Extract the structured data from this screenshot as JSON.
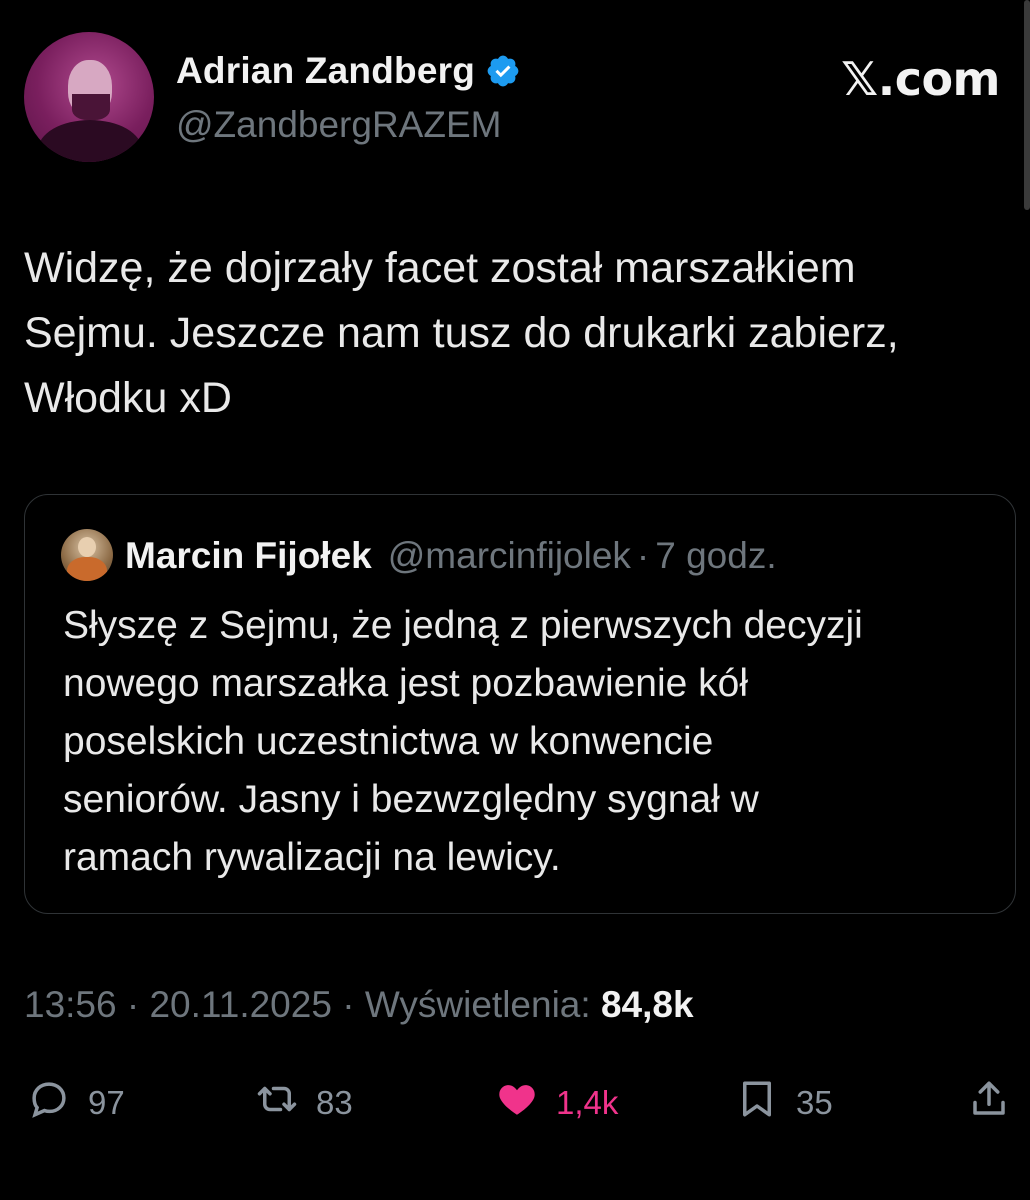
{
  "author": {
    "display_name": "Adrian Zandberg",
    "handle": "@ZandbergRAZEM",
    "verified": true
  },
  "brand": "𝕏.com",
  "tweet": {
    "text": "Widzę, że dojrzały facet został marszałkiem\nSejmu. Jeszcze nam tusz do drukarki zabierz,\nWłodku xD"
  },
  "quote": {
    "display_name": "Marcin Fijołek",
    "handle": "@marcinfijolek",
    "separator": "·",
    "time": "7 godz.",
    "text": "Słyszę z Sejmu, że jedną z pierwszych decyzji\nnowego marszałka jest pozbawienie kół\nposelskich uczestnictwa w konwencie\nseniorów. Jasny i bezwzględny sygnał w\nramach rywalizacji na lewicy."
  },
  "meta": {
    "time": "13:56",
    "separator": "·",
    "date": "20.11.2025",
    "views_label": "Wyświetlenia:",
    "views_value": "84,8k"
  },
  "actions": {
    "reply_count": "97",
    "repost_count": "83",
    "like_count": "1,4k",
    "bookmark_count": "35"
  },
  "colors": {
    "background": "#000000",
    "verified": "#1d9bf0",
    "like": "#f0338b",
    "muted": "#6e767d"
  },
  "icons": [
    "verified-badge-icon",
    "reply-icon",
    "repost-icon",
    "heart-icon",
    "bookmark-icon",
    "share-icon"
  ]
}
